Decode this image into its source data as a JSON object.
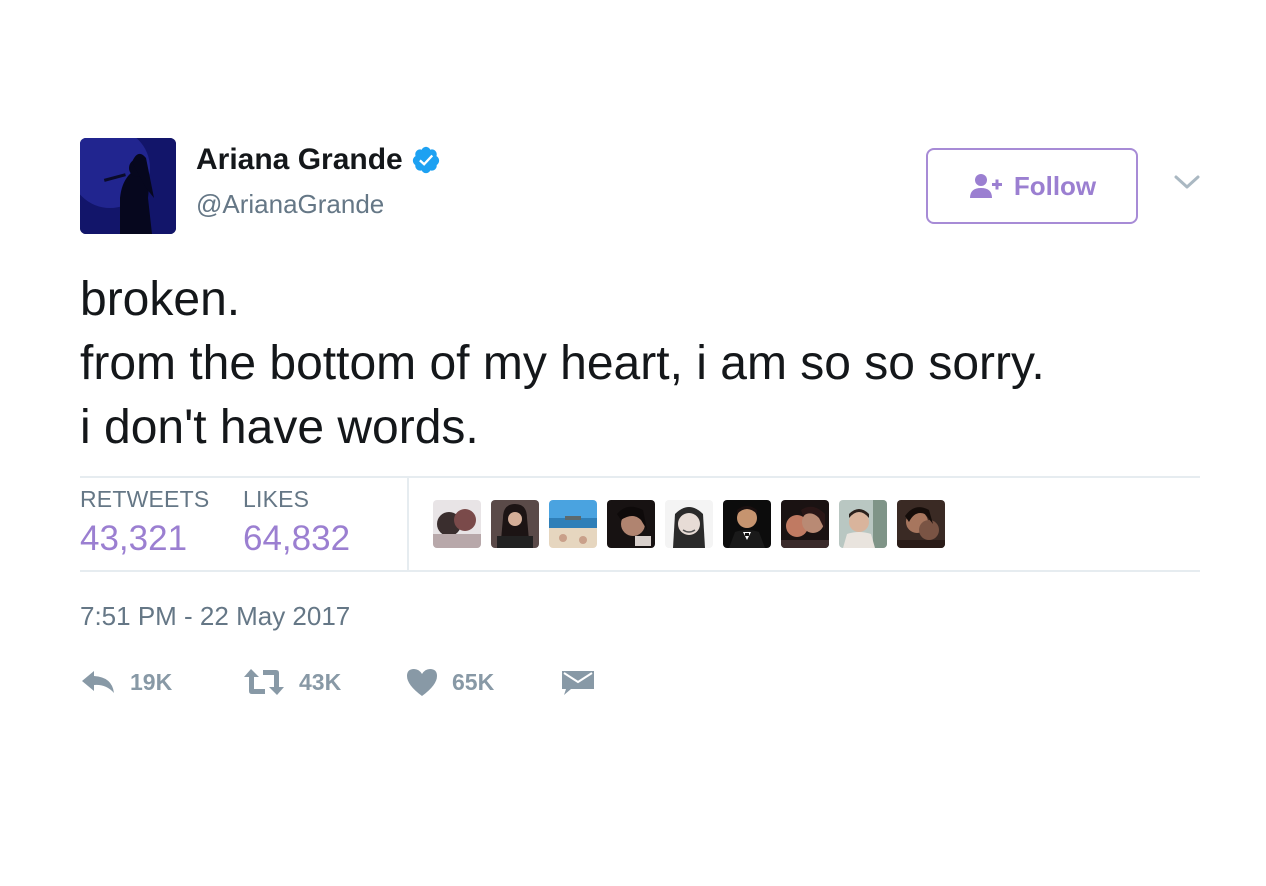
{
  "author": {
    "display_name": "Ariana Grande",
    "handle": "@ArianaGrande",
    "verified": true,
    "avatar": "avatar-photo"
  },
  "follow_button": {
    "label": "Follow",
    "icon": "follow-user-icon"
  },
  "menu": {
    "icon": "chevron-down-icon"
  },
  "tweet": {
    "lines": [
      "broken.",
      "from the bottom of my heart, i am so so sorry.",
      "i don't have words."
    ]
  },
  "stats": {
    "retweets_label": "RETWEETS",
    "retweets_value": "43,321",
    "likes_label": "LIKES",
    "likes_value": "64,832",
    "liker_avatars_count_shown": 9
  },
  "timestamp": "7:51 PM - 22 May 2017",
  "actions": {
    "reply": {
      "icon": "reply-icon",
      "count": "19K"
    },
    "retweet": {
      "icon": "retweet-icon",
      "count": "43K"
    },
    "like": {
      "icon": "heart-icon",
      "count": "65K"
    },
    "message": {
      "icon": "envelope-icon"
    }
  },
  "colors": {
    "accent": "#9b7fd1",
    "verified": "#1da1f2",
    "secondary_text": "#657786",
    "action_gray": "#8899a6",
    "divider": "#e6ecf0"
  }
}
